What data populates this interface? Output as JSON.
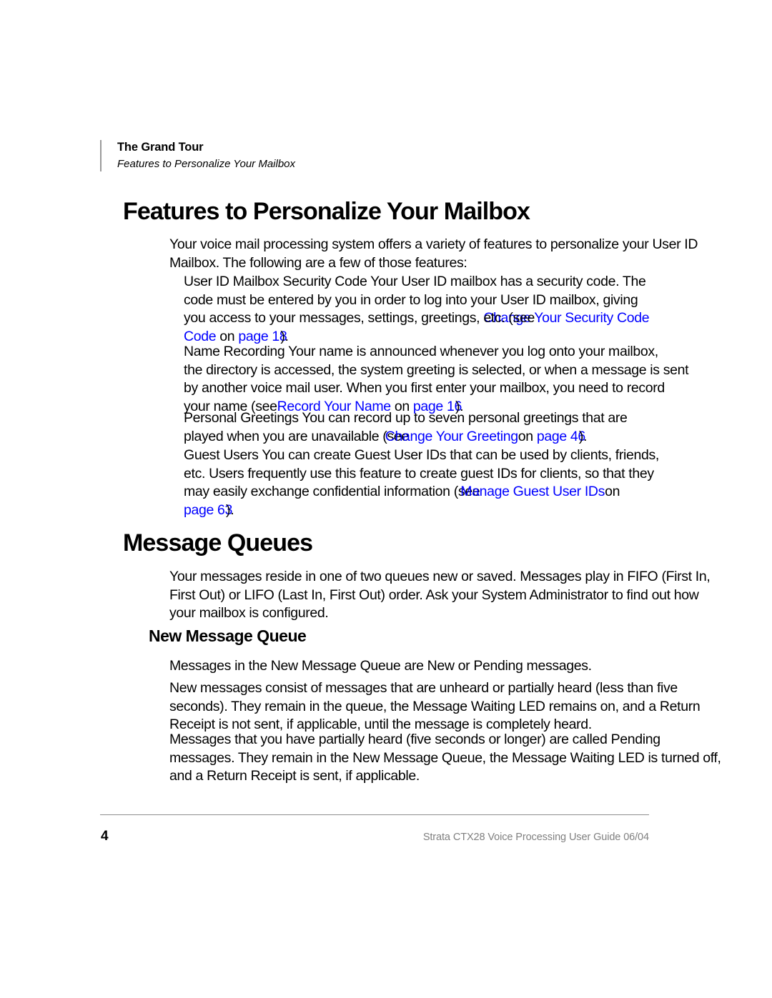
{
  "document": {
    "page_number": "4",
    "guide_footer": "Strata CTX28 Voice Processing User Guide   06/04"
  },
  "running_header": {
    "chapter": "The Grand Tour",
    "section": "Features to Personalize Your Mailbox"
  },
  "headings": {
    "h1_features": "Features to Personalize Your Mailbox",
    "h1_queues": "Message Queues",
    "h2_new_queue": "New Message Queue"
  },
  "body": {
    "intro": "Your voice mail processing system offers a variety of features to personalize your User ID Mailbox. The following are a few of those features:",
    "security_code": {
      "text_before": "User ID Mailbox Security Code   Your User ID mailbox has a security code. The code must be entered by you in order to  log into  your User ID mailbox, giving you access to your messages, settings, greetings, etc. (see",
      "overlap_black": "etc. (see",
      "link_title": "Change Your Security Code",
      "on_word": " on ",
      "link_page": "page 18",
      "close": ")."
    },
    "name_recording": {
      "text_before": "Name Recording  Your name is announced whenever you log onto your mailbox, the directory is accessed, the system greeting is selected, or when a message is sent by another voice mail user. When you first enter your mailbox, you need to record your name (see",
      "overlap_black": "(see",
      "link_title": "Record Your Name",
      "on_word": " on ",
      "link_page": "page 16",
      "close": ")."
    },
    "personal_greetings": {
      "text_before": "Personal Greetings  You can record up to seven personal greetings that are played when you are unavailable (see",
      "overlap_black": "(see",
      "link_title": "Change Your Greeting",
      "on_word": "on ",
      "link_page": "page 46",
      "close": ")."
    },
    "guest_users": {
      "text_before": "Guest Users  You can create Guest User IDs that can be used by clients, friends, etc. Users frequently use this feature to create guest IDs for clients, so that they may easily exchange confidential information (see",
      "overlap_black": "(see",
      "link_title": "Manage Guest User IDs",
      "on_word": "on ",
      "link_page": "page 63",
      "close": ")."
    },
    "queues_intro": "Your messages reside in one of two queues new or saved. Messages play in FIFO (First In, First Out) or LIFO (Last In, First Out) order. Ask your System Administrator to find out how your mailbox is configured.",
    "new_queue_1": "Messages in the New Message Queue are New or Pending messages.",
    "new_queue_2": "New messages consist of messages that are unheard or partially heard (less than five seconds). They remain in the queue, the Message Waiting LED remains on, and a Return Receipt is not sent, if applicable, until the message is completely heard.",
    "new_queue_3": "Messages that you have partially heard (five seconds or longer) are called Pending messages. They remain in the New Message Queue, the Message Waiting LED is turned off, and a Return Receipt is sent, if applicable."
  },
  "fragments": {
    "sec_line1": "User ID Mailbox Security Code   Your User ID mailbox has a security code. The",
    "sec_line2": "code must be entered by you in order to  log into  your User ID mailbox, giving",
    "sec_line3a": "you access to your messages, settings, greetings, ",
    "sec_line4a": "Code",
    "sec_line4b": " on ",
    "name_line1": "Name Recording  Your name is announced whenever you log onto your mailbox,",
    "name_line2": "the directory is accessed, the system greeting is selected, or when a message is sent",
    "name_line3": "by another voice mail user. When you first enter your mailbox, you need to record",
    "name_line4a": "your name (see",
    "name_line4b": " on ",
    "pg_line1": "Personal Greetings  You can record up to seven personal greetings that are",
    "pg_line2a": "played when you are unavailable (see",
    "pg_line2b": "on ",
    "gu_line1": "Guest Users  You can create Guest User IDs that can be used by clients, friends,",
    "gu_line2": "etc. Users frequently use this feature to create guest IDs for clients, so that they",
    "gu_line3a": "may easily exchange confidential information (see",
    "gu_line3b": "on",
    "colors": {
      "link": "#0000FF",
      "text": "#000000",
      "footer_gray": "#808080",
      "rule_gray": "#8D8D8D"
    }
  }
}
